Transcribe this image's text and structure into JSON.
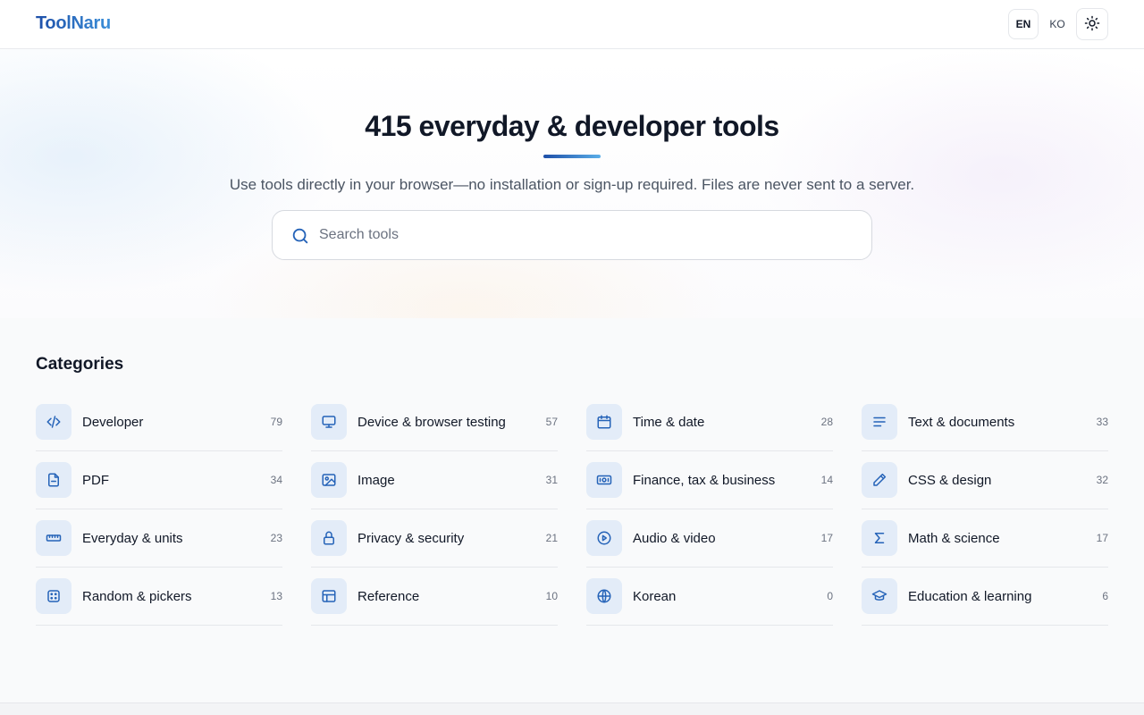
{
  "header": {
    "logo": "ToolNaru",
    "languages": [
      {
        "label": "EN",
        "active": true
      },
      {
        "label": "KO",
        "active": false
      }
    ],
    "theme_icon": "sun-icon"
  },
  "hero": {
    "title": "415 everyday & developer tools",
    "subtitle": "Use tools directly in your browser—no installation or sign-up required. Files are never sent to a server.",
    "search": {
      "placeholder": "Search tools",
      "value": ""
    }
  },
  "categories": {
    "heading": "Categories",
    "items": [
      {
        "name": "Developer",
        "count": "79",
        "icon": "code-icon"
      },
      {
        "name": "Device & browser testing",
        "count": "57",
        "icon": "monitor-icon"
      },
      {
        "name": "Time & date",
        "count": "28",
        "icon": "calendar-icon"
      },
      {
        "name": "Text & documents",
        "count": "33",
        "icon": "text-lines-icon"
      },
      {
        "name": "PDF",
        "count": "34",
        "icon": "file-icon"
      },
      {
        "name": "Image",
        "count": "31",
        "icon": "image-icon"
      },
      {
        "name": "Finance, tax & business",
        "count": "14",
        "icon": "banknote-icon"
      },
      {
        "name": "CSS & design",
        "count": "32",
        "icon": "pencil-icon"
      },
      {
        "name": "Everyday & units",
        "count": "23",
        "icon": "ruler-icon"
      },
      {
        "name": "Privacy & security",
        "count": "21",
        "icon": "lock-icon"
      },
      {
        "name": "Audio & video",
        "count": "17",
        "icon": "play-circle-icon"
      },
      {
        "name": "Math & science",
        "count": "17",
        "icon": "sigma-icon"
      },
      {
        "name": "Random & pickers",
        "count": "13",
        "icon": "dice-icon"
      },
      {
        "name": "Reference",
        "count": "10",
        "icon": "table-icon"
      },
      {
        "name": "Korean",
        "count": "0",
        "icon": "globe-icon"
      },
      {
        "name": "Education & learning",
        "count": "6",
        "icon": "graduation-cap-icon"
      }
    ]
  },
  "colors": {
    "accent": "#1e4fa8",
    "icon_stroke": "#2563b8",
    "icon_bg": "#e3ecf8"
  }
}
